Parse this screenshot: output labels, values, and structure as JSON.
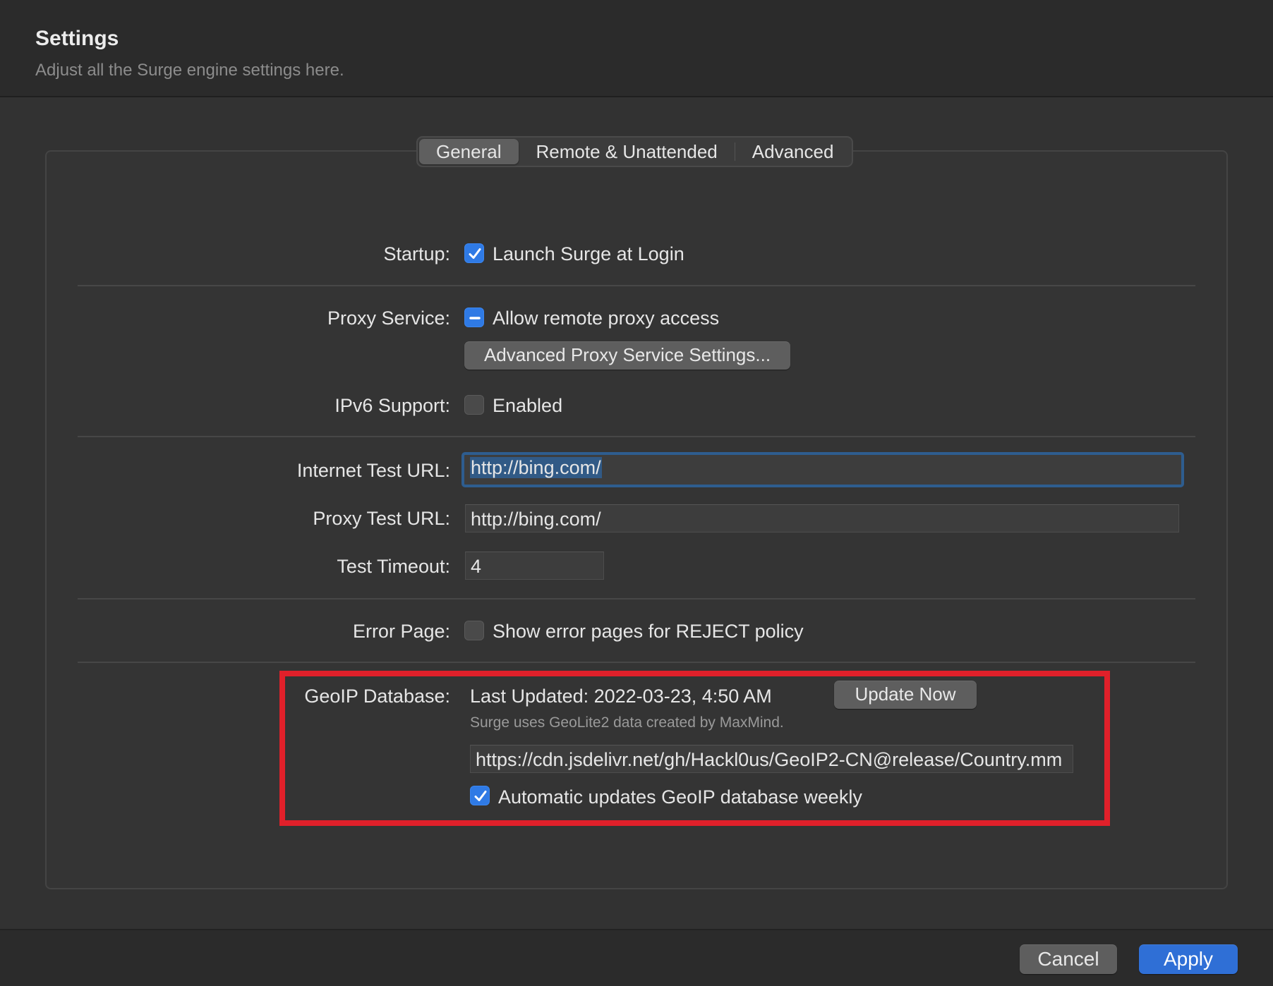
{
  "header": {
    "title": "Settings",
    "subtitle": "Adjust all the Surge engine settings here."
  },
  "tabs": [
    {
      "label": "General",
      "active": true
    },
    {
      "label": "Remote & Unattended",
      "active": false
    },
    {
      "label": "Advanced",
      "active": false
    }
  ],
  "startup": {
    "label": "Startup:",
    "option": "Launch Surge at Login",
    "checked": true
  },
  "proxy_service": {
    "label": "Proxy Service:",
    "option": "Allow remote proxy access",
    "state": "mixed",
    "button": "Advanced Proxy Service Settings..."
  },
  "ipv6": {
    "label": "IPv6 Support:",
    "option": "Enabled",
    "checked": false
  },
  "internet_test": {
    "label": "Internet Test URL:",
    "value": "http://bing.com/"
  },
  "proxy_test": {
    "label": "Proxy Test URL:",
    "value": "http://bing.com/"
  },
  "timeout": {
    "label": "Test Timeout:",
    "value": "4"
  },
  "error_page": {
    "label": "Error Page:",
    "option": "Show error pages for REJECT policy",
    "checked": false
  },
  "geoip": {
    "label": "GeoIP Database:",
    "last_updated": "Last Updated: 2022-03-23, 4:50 AM",
    "update_button": "Update Now",
    "caption": "Surge uses GeoLite2 data created by MaxMind.",
    "url": "https://cdn.jsdelivr.net/gh/Hackl0us/GeoIP2-CN@release/Country.mm",
    "auto_update": "Automatic updates GeoIP database weekly",
    "auto_update_checked": true
  },
  "footer": {
    "cancel": "Cancel",
    "apply": "Apply"
  },
  "colors": {
    "accent": "#2f7ae5",
    "highlight": "#e0202a",
    "apply": "#2f6fd6"
  }
}
